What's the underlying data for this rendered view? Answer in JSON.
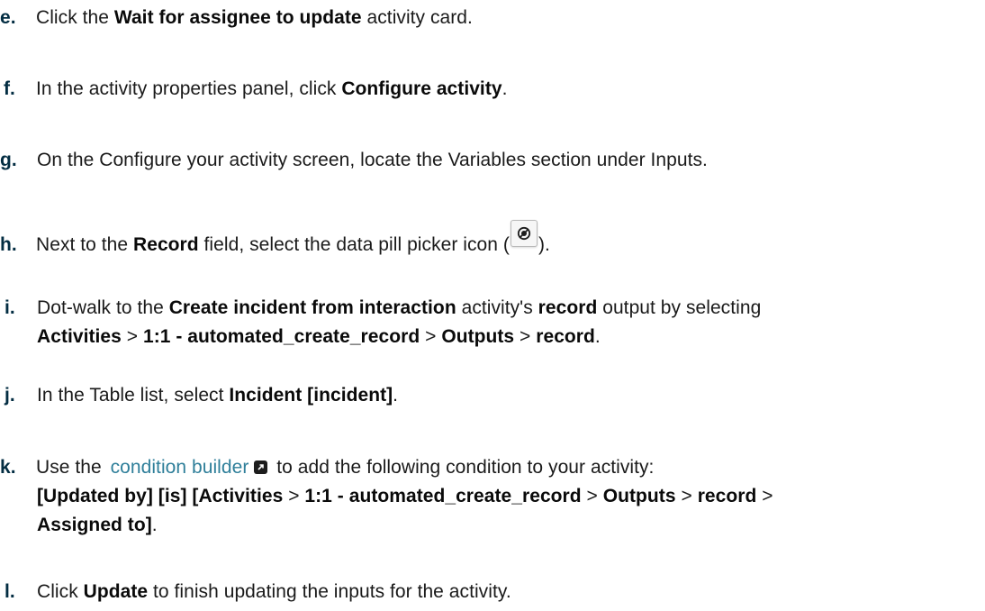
{
  "steps": [
    {
      "letter": "e.",
      "t1": "Click the ",
      "b1": "Wait for assignee to update",
      "t2": " activity card."
    },
    {
      "letter": "f.",
      "t1": "In the activity properties panel, click ",
      "b1": "Configure activity",
      "t2": "."
    },
    {
      "letter": "g.",
      "t1": "On the Configure your activity screen, locate the Variables section under Inputs."
    },
    {
      "letter": "h.",
      "t1": "Next to the ",
      "b1": "Record",
      "t2": " field, select the data pill picker icon (",
      "t3": ")."
    },
    {
      "letter": "i.",
      "t1": "Dot-walk to the ",
      "b1": "Create incident from interaction",
      "t2": " activity's ",
      "b2": "record",
      "t3": " output by selecting",
      "line2": {
        "b1": "Activities",
        "s1": " > ",
        "b2": "1:1 - automated_create_record",
        "s2": " > ",
        "b3": "Outputs",
        "s3": " > ",
        "b4": "record",
        "end": "."
      }
    },
    {
      "letter": "j.",
      "t1": "In the Table list, select ",
      "b1": "Incident [incident]",
      "t2": "."
    },
    {
      "letter": "k.",
      "t1": "Use the ",
      "link": "condition builder",
      "t2": " to add the following condition to your activity:",
      "line2": {
        "b1": "[Updated by] [is] [Activities",
        "s1": " > ",
        "b2": "1:1 - automated_create_record",
        "s2": " > ",
        "b3": "Outputs",
        "s3": " > ",
        "b4": "record",
        "s4": " >"
      },
      "line3": {
        "b1": "Assigned to]",
        "end": "."
      }
    },
    {
      "letter": "l.",
      "t1": "Click ",
      "b1": "Update",
      "t2": " to finish updating the inputs for the activity."
    }
  ],
  "colors": {
    "text": "#1a1a1a",
    "link": "#2f7f9a",
    "letter": "#032d42"
  },
  "icons": {
    "link_icon": "external-link-icon",
    "picker_icon": "data-pill-picker-icon"
  }
}
